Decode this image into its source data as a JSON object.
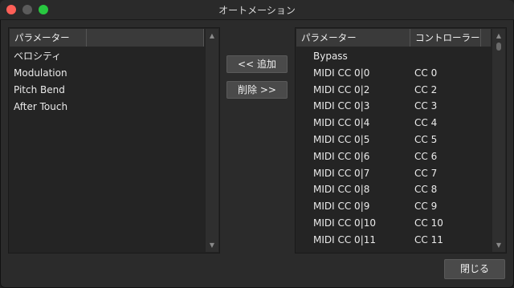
{
  "window": {
    "title": "オートメーション"
  },
  "left_panel": {
    "header": "パラメーター",
    "items": [
      "ベロシティ",
      "Modulation",
      "Pitch Bend",
      "After Touch"
    ]
  },
  "buttons": {
    "add_label": "<< 追加",
    "remove_label": "削除 >>",
    "close_label": "閉じる"
  },
  "right_panel": {
    "headers": {
      "parameter": "パラメーター",
      "controller": "コントローラー"
    },
    "rows": [
      {
        "parameter": "Bypass",
        "controller": ""
      },
      {
        "parameter": "MIDI CC 0|0",
        "controller": "CC 0"
      },
      {
        "parameter": "MIDI CC 0|2",
        "controller": "CC 2"
      },
      {
        "parameter": "MIDI CC 0|3",
        "controller": "CC 3"
      },
      {
        "parameter": "MIDI CC 0|4",
        "controller": "CC 4"
      },
      {
        "parameter": "MIDI CC 0|5",
        "controller": "CC 5"
      },
      {
        "parameter": "MIDI CC 0|6",
        "controller": "CC 6"
      },
      {
        "parameter": "MIDI CC 0|7",
        "controller": "CC 7"
      },
      {
        "parameter": "MIDI CC 0|8",
        "controller": "CC 8"
      },
      {
        "parameter": "MIDI CC 0|9",
        "controller": "CC 9"
      },
      {
        "parameter": "MIDI CC 0|10",
        "controller": "CC 10"
      },
      {
        "parameter": "MIDI CC 0|11",
        "controller": "CC 11"
      }
    ]
  }
}
